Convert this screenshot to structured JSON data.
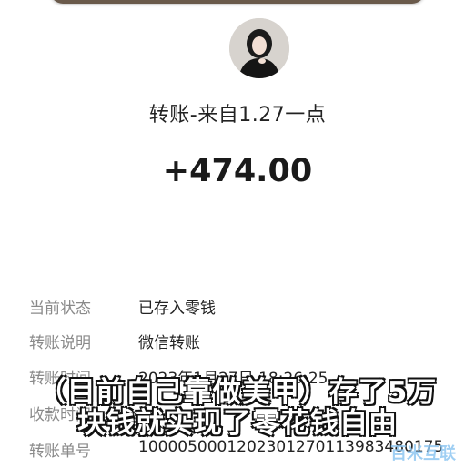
{
  "transfer": {
    "title": "转账-来自1.27一点",
    "amount": "+474.00"
  },
  "details": {
    "status_label": "当前状态",
    "status_value": "已存入零钱",
    "note_label": "转账说明",
    "note_value": "微信转账",
    "time_label": "转账时间",
    "time_value": "2023年1月27日 18:26:25",
    "receive_label": "收款时间",
    "receive_value": "",
    "order_label": "转账单号",
    "order_value": "1000050001202301270113983480175"
  },
  "caption": {
    "line1": "（目前自己靠做美甲）存了5万",
    "line2": "块钱就实现了零花钱自由"
  },
  "watermark": {
    "text": "百米互联"
  },
  "colors": {
    "background": "#ffffff",
    "label_gray": "#8a8a8a",
    "text_dark": "#1a1a1a",
    "top_bar": "#6a5a4b"
  }
}
